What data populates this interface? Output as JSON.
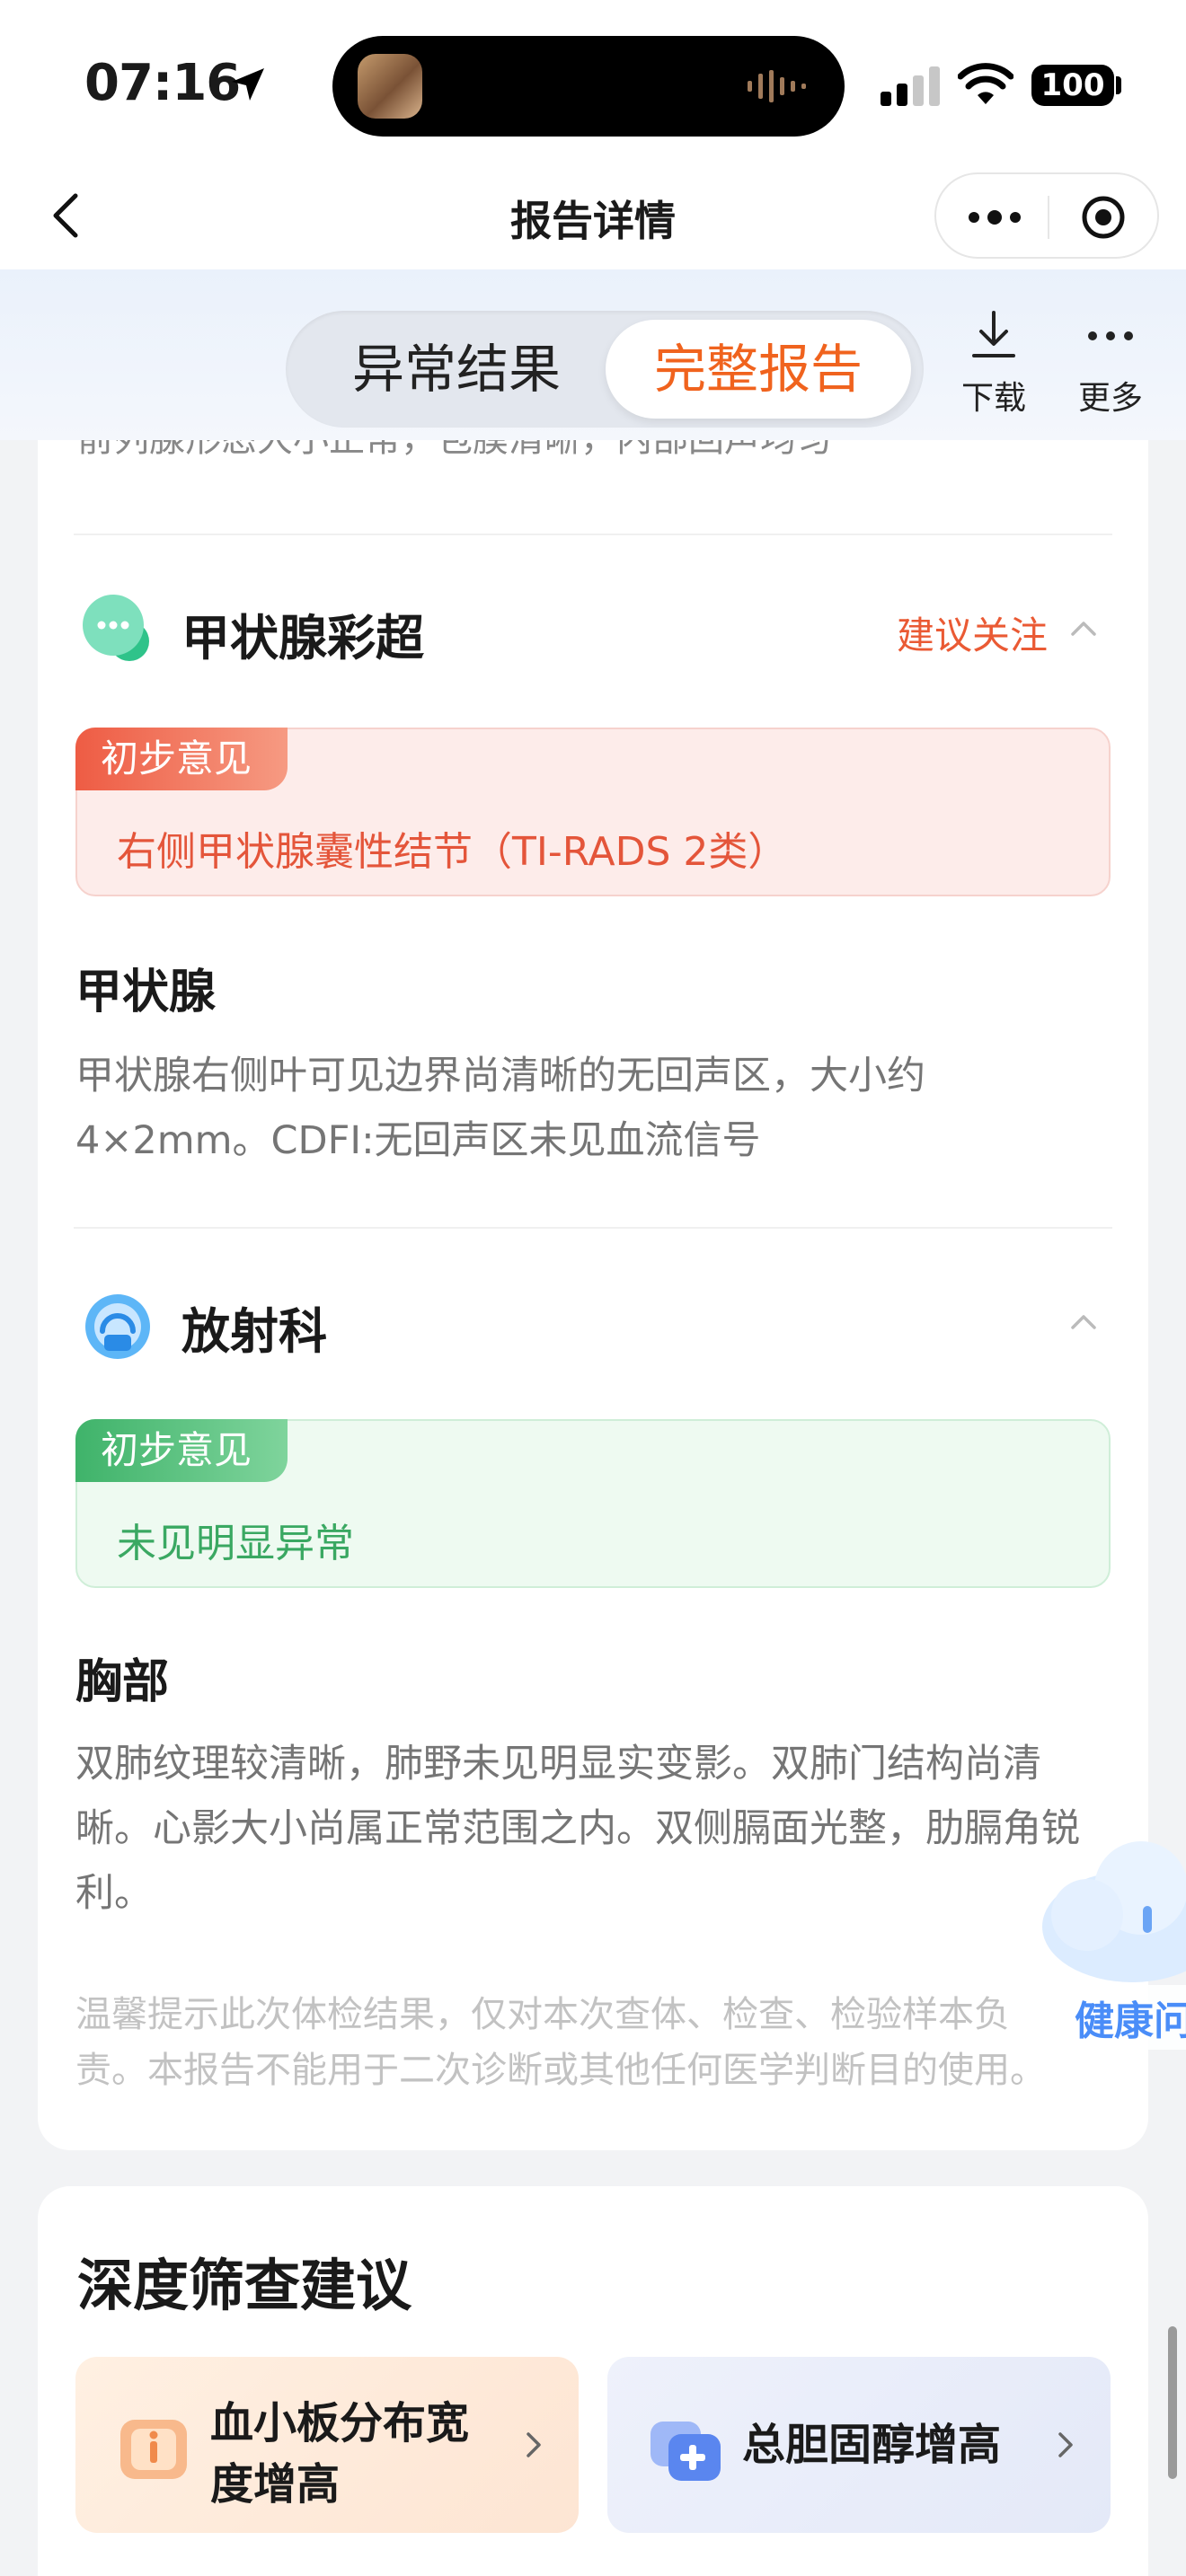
{
  "status_bar": {
    "time": "07:16",
    "battery": "100"
  },
  "nav": {
    "title": "报告详情"
  },
  "tabs": {
    "items": [
      {
        "label": "异常结果",
        "active": false
      },
      {
        "label": "完整报告",
        "active": true
      }
    ],
    "download_label": "下载",
    "more_label": "更多"
  },
  "report": {
    "cut_text": "前列腺形态大小正常，包膜清晰，内部回声均匀",
    "sections": [
      {
        "title": "甲状腺彩超",
        "tag": "建议关注",
        "opinion_label": "初步意见",
        "opinion_text": "右侧甲状腺囊性结节（TI-RADS 2类）",
        "sub_title": "甲状腺",
        "description": "甲状腺右侧叶可见边界尚清晰的无回声区，大小约4×2mm。CDFI:无回声区未见血流信号"
      },
      {
        "title": "放射科",
        "opinion_label": "初步意见",
        "opinion_text": "未见明显异常",
        "sub_title": "胸部",
        "description": "双肺纹理较清晰，肺野未见明显实变影。双肺门结构尚清晰。心影大小尚属正常范围之内。双侧膈面光整，肋膈角锐利。"
      }
    ],
    "tip": "温馨提示此次体检结果，仅对本次查体、检查、检验样本负责。本报告不能用于二次诊断或其他任何医学判断目的使用。"
  },
  "assistant": {
    "label": "健康问"
  },
  "screening": {
    "title": "深度筛查建议",
    "items": [
      {
        "label": "血小板分布宽度增高"
      },
      {
        "label": "总胆固醇增高"
      }
    ]
  },
  "colors": {
    "accent_orange": "#f0631e",
    "alert_red": "#ea5a34",
    "normal_green": "#3aa862",
    "assistant_blue": "#4a8df8"
  }
}
